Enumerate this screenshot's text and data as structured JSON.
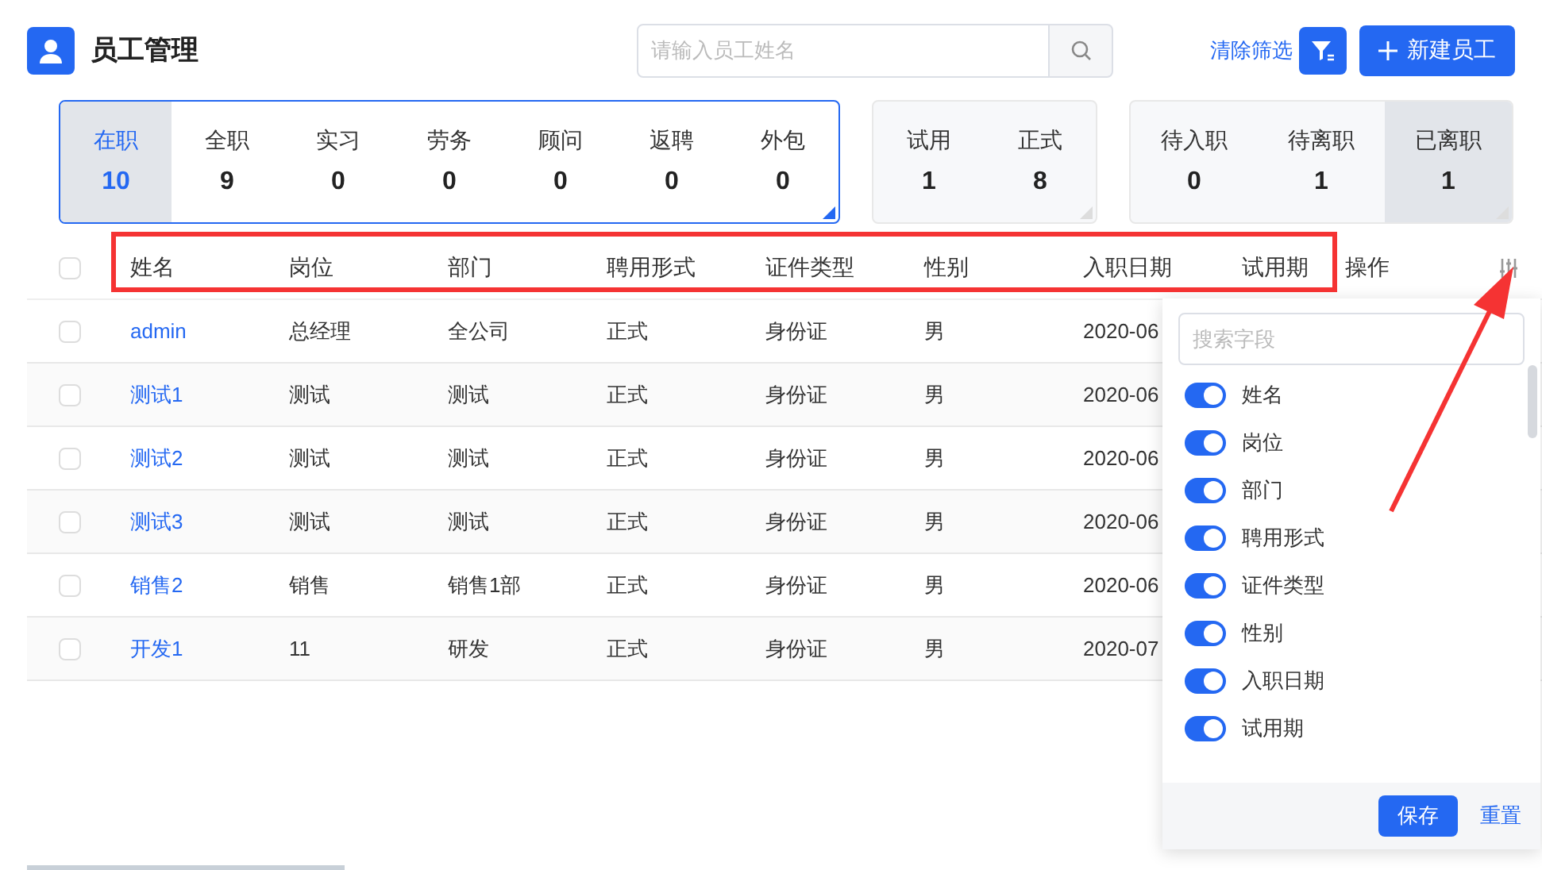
{
  "header": {
    "title": "员工管理",
    "search": {
      "placeholder": "请输入员工姓名"
    },
    "clear_filter": "清除筛选",
    "new_button": "新建员工"
  },
  "stat_groups": [
    {
      "selected": true,
      "items": [
        {
          "label": "在职",
          "count": "10",
          "selected": true,
          "shaded": true
        },
        {
          "label": "全职",
          "count": "9",
          "selected": false,
          "shaded": false
        },
        {
          "label": "实习",
          "count": "0",
          "selected": false,
          "shaded": false
        },
        {
          "label": "劳务",
          "count": "0",
          "selected": false,
          "shaded": false
        },
        {
          "label": "顾问",
          "count": "0",
          "selected": false,
          "shaded": false
        },
        {
          "label": "返聘",
          "count": "0",
          "selected": false,
          "shaded": false
        },
        {
          "label": "外包",
          "count": "0",
          "selected": false,
          "shaded": false
        }
      ]
    },
    {
      "selected": false,
      "items": [
        {
          "label": "试用",
          "count": "1",
          "selected": false,
          "shaded": false
        },
        {
          "label": "正式",
          "count": "8",
          "selected": false,
          "shaded": false
        }
      ]
    },
    {
      "selected": false,
      "items": [
        {
          "label": "待入职",
          "count": "0",
          "selected": false,
          "shaded": false
        },
        {
          "label": "待离职",
          "count": "1",
          "selected": false,
          "shaded": false
        },
        {
          "label": "已离职",
          "count": "1",
          "selected": false,
          "shaded": true
        }
      ]
    }
  ],
  "table": {
    "select_all": {
      "checked": false
    },
    "columns": [
      "姓名",
      "岗位",
      "部门",
      "聘用形式",
      "证件类型",
      "性别",
      "入职日期",
      "试用期"
    ],
    "action_column": "操作",
    "rows": [
      {
        "checked": false,
        "cells": [
          "admin",
          "总经理",
          "全公司",
          "正式",
          "身份证",
          "男",
          "2020-06"
        ]
      },
      {
        "checked": false,
        "cells": [
          "测试1",
          "测试",
          "测试",
          "正式",
          "身份证",
          "男",
          "2020-06"
        ]
      },
      {
        "checked": false,
        "cells": [
          "测试2",
          "测试",
          "测试",
          "正式",
          "身份证",
          "男",
          "2020-06"
        ]
      },
      {
        "checked": false,
        "cells": [
          "测试3",
          "测试",
          "测试",
          "正式",
          "身份证",
          "男",
          "2020-06"
        ]
      },
      {
        "checked": false,
        "cells": [
          "销售2",
          "销售",
          "销售1部",
          "正式",
          "身份证",
          "男",
          "2020-06"
        ]
      },
      {
        "checked": false,
        "cells": [
          "开发1",
          "11",
          "研发",
          "正式",
          "身份证",
          "男",
          "2020-07"
        ]
      }
    ]
  },
  "column_picker": {
    "search": {
      "placeholder": "搜索字段"
    },
    "fields": [
      {
        "label": "姓名",
        "on": true
      },
      {
        "label": "岗位",
        "on": true
      },
      {
        "label": "部门",
        "on": true
      },
      {
        "label": "聘用形式",
        "on": true
      },
      {
        "label": "证件类型",
        "on": true
      },
      {
        "label": "性别",
        "on": true
      },
      {
        "label": "入职日期",
        "on": true
      },
      {
        "label": "试用期",
        "on": true
      }
    ],
    "save": "保存",
    "reset": "重置"
  }
}
